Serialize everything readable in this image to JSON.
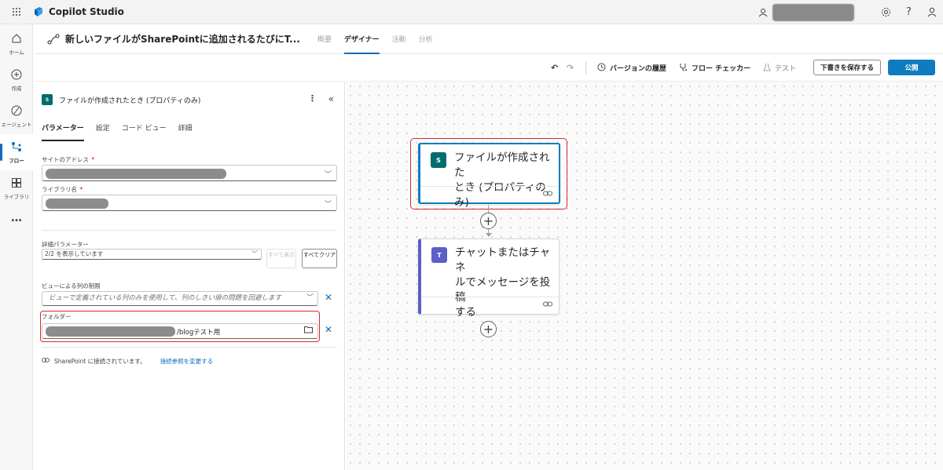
{
  "app": {
    "name": "Copilot Studio",
    "waffle_icon": "waffle-icon",
    "logo_icon": "copilot-studio-logo",
    "brand_color": "#0f6cbd"
  },
  "top_right": {
    "icons": [
      "environment-icon",
      "settings-icon",
      "help-icon",
      "user-icon"
    ],
    "help_label": "?"
  },
  "rail": {
    "items": [
      {
        "label": "ホーム",
        "icon": "home-icon"
      },
      {
        "label": "作成",
        "icon": "create-icon"
      },
      {
        "label": "エージェント",
        "icon": "agent-icon"
      },
      {
        "label": "フロー",
        "icon": "flow-icon",
        "active": true
      },
      {
        "label": "ライブラリ",
        "icon": "library-icon"
      },
      {
        "label": "…",
        "icon": "more-icon"
      }
    ]
  },
  "header": {
    "title": "新しいファイルがSharePointに追加されるたびにT...",
    "tabs": [
      {
        "label": "概要",
        "state": "disabled"
      },
      {
        "label": "デザイナー",
        "state": "active"
      },
      {
        "label": "活動",
        "state": "disabled"
      },
      {
        "label": "分析",
        "state": "disabled"
      }
    ]
  },
  "commands": {
    "version_history": "バージョンの履歴",
    "flow_checker": "フロー チェッカー",
    "test": "テスト",
    "save_draft": "下書きを保存する",
    "publish": "公開",
    "publish_color": "#0f7cc0"
  },
  "panel": {
    "title": "ファイルが作成されたとき (プロパティのみ)",
    "icon_text": "S",
    "tabs": [
      "パラメーター",
      "設定",
      "コード ビュー",
      "詳細"
    ],
    "site_address_label": "サイトのアドレス",
    "library_label": "ライブラリ名",
    "required_mark": "*",
    "advanced_label": "詳細パラメーター",
    "advanced_value": "2/2 を表示しています",
    "show_all": "すべて表示",
    "clear_all": "すべてクリア",
    "column_limit_label": "ビューによる列の制限",
    "column_limit_placeholder": "ビューで定義されている列のみを使用して、列のしきい値の問題を回避します",
    "folder_label": "フォルダー",
    "folder_value": "/blogテスト用",
    "connection_text": "SharePoint に接続されています。",
    "change_connection": "接続参照を変更する"
  },
  "canvas": {
    "trigger_card": {
      "title_line1": "ファイルが作成された",
      "title_line2": "とき (プロパティのみ)",
      "icon_text": "S",
      "icon_color": "#036c70",
      "accent": "#0f7cc0"
    },
    "action_card": {
      "title_line1": "チャットまたはチャネ",
      "title_line2": "ルでメッセージを投稿",
      "title_line3": "する",
      "icon_text": "T",
      "icon_color": "#5b5fc7",
      "accent": "#5b5fc7"
    },
    "highlight_color": "#e0262b"
  }
}
